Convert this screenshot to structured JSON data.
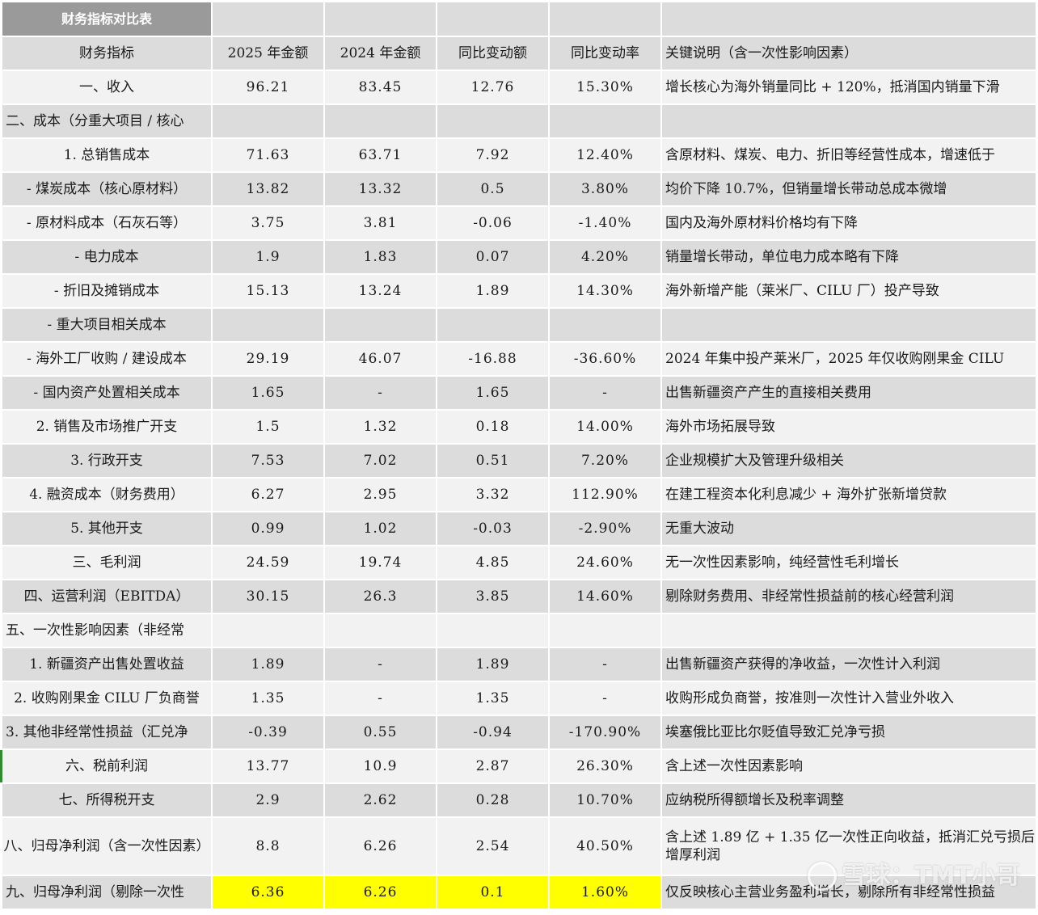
{
  "title": "财务指标对比表",
  "headers": [
    "财务指标",
    "2025 年金额",
    "2024 年金额",
    "同比变动额",
    "同比变动率",
    "关键说明（含一次性影响因素）"
  ],
  "rows": [
    {
      "name": "一、收入",
      "align": "c",
      "y2025": "96.21",
      "y2024": "83.45",
      "chg": "12.76",
      "rate": "15.30%",
      "note": "增长核心为海外销量同比 + 120%，抵消国内销量下滑"
    },
    {
      "name": "二、成本（分重大项目 / 核心",
      "align": "l",
      "y2025": "",
      "y2024": "",
      "chg": "",
      "rate": "",
      "note": ""
    },
    {
      "name": "1. 总销售成本",
      "align": "c",
      "y2025": "71.63",
      "y2024": "63.71",
      "chg": "7.92",
      "rate": "12.40%",
      "note": "含原材料、煤炭、电力、折旧等经营性成本，增速低于"
    },
    {
      "name": "- 煤炭成本（核心原材料）",
      "align": "c",
      "y2025": "13.82",
      "y2024": "13.32",
      "chg": "0.5",
      "rate": "3.80%",
      "note": "均价下降 10.7%，但销量增长带动总成本微增"
    },
    {
      "name": "- 原材料成本（石灰石等）",
      "align": "c",
      "y2025": "3.75",
      "y2024": "3.81",
      "chg": "-0.06",
      "rate": "-1.40%",
      "note": "国内及海外原材料价格均有下降"
    },
    {
      "name": "- 电力成本",
      "align": "c",
      "y2025": "1.9",
      "y2024": "1.83",
      "chg": "0.07",
      "rate": "4.20%",
      "note": "销量增长带动，单位电力成本略有下降"
    },
    {
      "name": "- 折旧及摊销成本",
      "align": "c",
      "y2025": "15.13",
      "y2024": "13.24",
      "chg": "1.89",
      "rate": "14.30%",
      "note": "海外新增产能（莱米厂、CILU 厂）投产导致"
    },
    {
      "name": "- 重大项目相关成本",
      "align": "c",
      "y2025": "",
      "y2024": "",
      "chg": "",
      "rate": "",
      "note": ""
    },
    {
      "name": "- 海外工厂收购 / 建设成本",
      "align": "c",
      "y2025": "29.19",
      "y2024": "46.07",
      "chg": "-16.88",
      "rate": "-36.60%",
      "note": "2024 年集中投产莱米厂，2025 年仅收购刚果金 CILU"
    },
    {
      "name": "- 国内资产处置相关成本",
      "align": "c",
      "y2025": "1.65",
      "y2024": "-",
      "chg": "1.65",
      "rate": "-",
      "note": "出售新疆资产产生的直接相关费用"
    },
    {
      "name": "2. 销售及市场推广开支",
      "align": "c",
      "y2025": "1.5",
      "y2024": "1.32",
      "chg": "0.18",
      "rate": "14.00%",
      "note": "海外市场拓展导致"
    },
    {
      "name": "3. 行政开支",
      "align": "c",
      "y2025": "7.53",
      "y2024": "7.02",
      "chg": "0.51",
      "rate": "7.20%",
      "note": "企业规模扩大及管理升级相关"
    },
    {
      "name": "4. 融资成本（财务费用）",
      "align": "c",
      "y2025": "6.27",
      "y2024": "2.95",
      "chg": "3.32",
      "rate": "112.90%",
      "note": "在建工程资本化利息减少 + 海外扩张新增贷款"
    },
    {
      "name": "5. 其他开支",
      "align": "c",
      "y2025": "0.99",
      "y2024": "1.02",
      "chg": "-0.03",
      "rate": "-2.90%",
      "note": "无重大波动"
    },
    {
      "name": "三、毛利润",
      "align": "c",
      "y2025": "24.59",
      "y2024": "19.74",
      "chg": "4.85",
      "rate": "24.60%",
      "note": "无一次性因素影响，纯经营性毛利增长"
    },
    {
      "name": "四、运营利润（EBITDA）",
      "align": "c",
      "y2025": "30.15",
      "y2024": "26.3",
      "chg": "3.85",
      "rate": "14.60%",
      "note": "剔除财务费用、非经常性损益前的核心经营利润"
    },
    {
      "name": "五、一次性影响因素（非经常",
      "align": "l",
      "y2025": "",
      "y2024": "",
      "chg": "",
      "rate": "",
      "note": ""
    },
    {
      "name": "1. 新疆资产出售处置收益",
      "align": "c",
      "y2025": "1.89",
      "y2024": "-",
      "chg": "1.89",
      "rate": "-",
      "note": "出售新疆资产获得的净收益，一次性计入利润"
    },
    {
      "name": "2. 收购刚果金 CILU 厂负商誉",
      "align": "c",
      "y2025": "1.35",
      "y2024": "-",
      "chg": "1.35",
      "rate": "-",
      "note": "收购形成负商誉，按准则一次性计入营业外收入"
    },
    {
      "name": "3. 其他非经常性损益（汇兑净",
      "align": "l",
      "y2025": "-0.39",
      "y2024": "0.55",
      "chg": "-0.94",
      "rate": "-170.90%",
      "note": "埃塞俄比亚比尔贬值导致汇兑净亏损"
    },
    {
      "name": "六、税前利润",
      "align": "c",
      "y2025": "13.77",
      "y2024": "10.9",
      "chg": "2.87",
      "rate": "26.30%",
      "note": "含上述一次性因素影响"
    },
    {
      "name": "七、所得税开支",
      "align": "c",
      "y2025": "2.9",
      "y2024": "2.62",
      "chg": "0.28",
      "rate": "10.70%",
      "note": "应纳税所得额增长及税率调整"
    },
    {
      "name": "八、归母净利润（含一次性因素）",
      "align": "c",
      "y2025": "8.8",
      "y2024": "6.26",
      "chg": "2.54",
      "rate": "40.50%",
      "note": "含上述 1.89 亿 + 1.35 亿一次性正向收益，抵消汇兑亏损后增厚利润"
    },
    {
      "name": "九、归母净利润（剔除一次性",
      "align": "l",
      "y2025": "6.36",
      "y2024": "6.26",
      "chg": "0.1",
      "rate": "1.60%",
      "note": "仅反映核心主营业务盈利增长，剔除所有非经常性损益",
      "highlight": true
    }
  ],
  "watermark": "雪球：TMT小哥"
}
